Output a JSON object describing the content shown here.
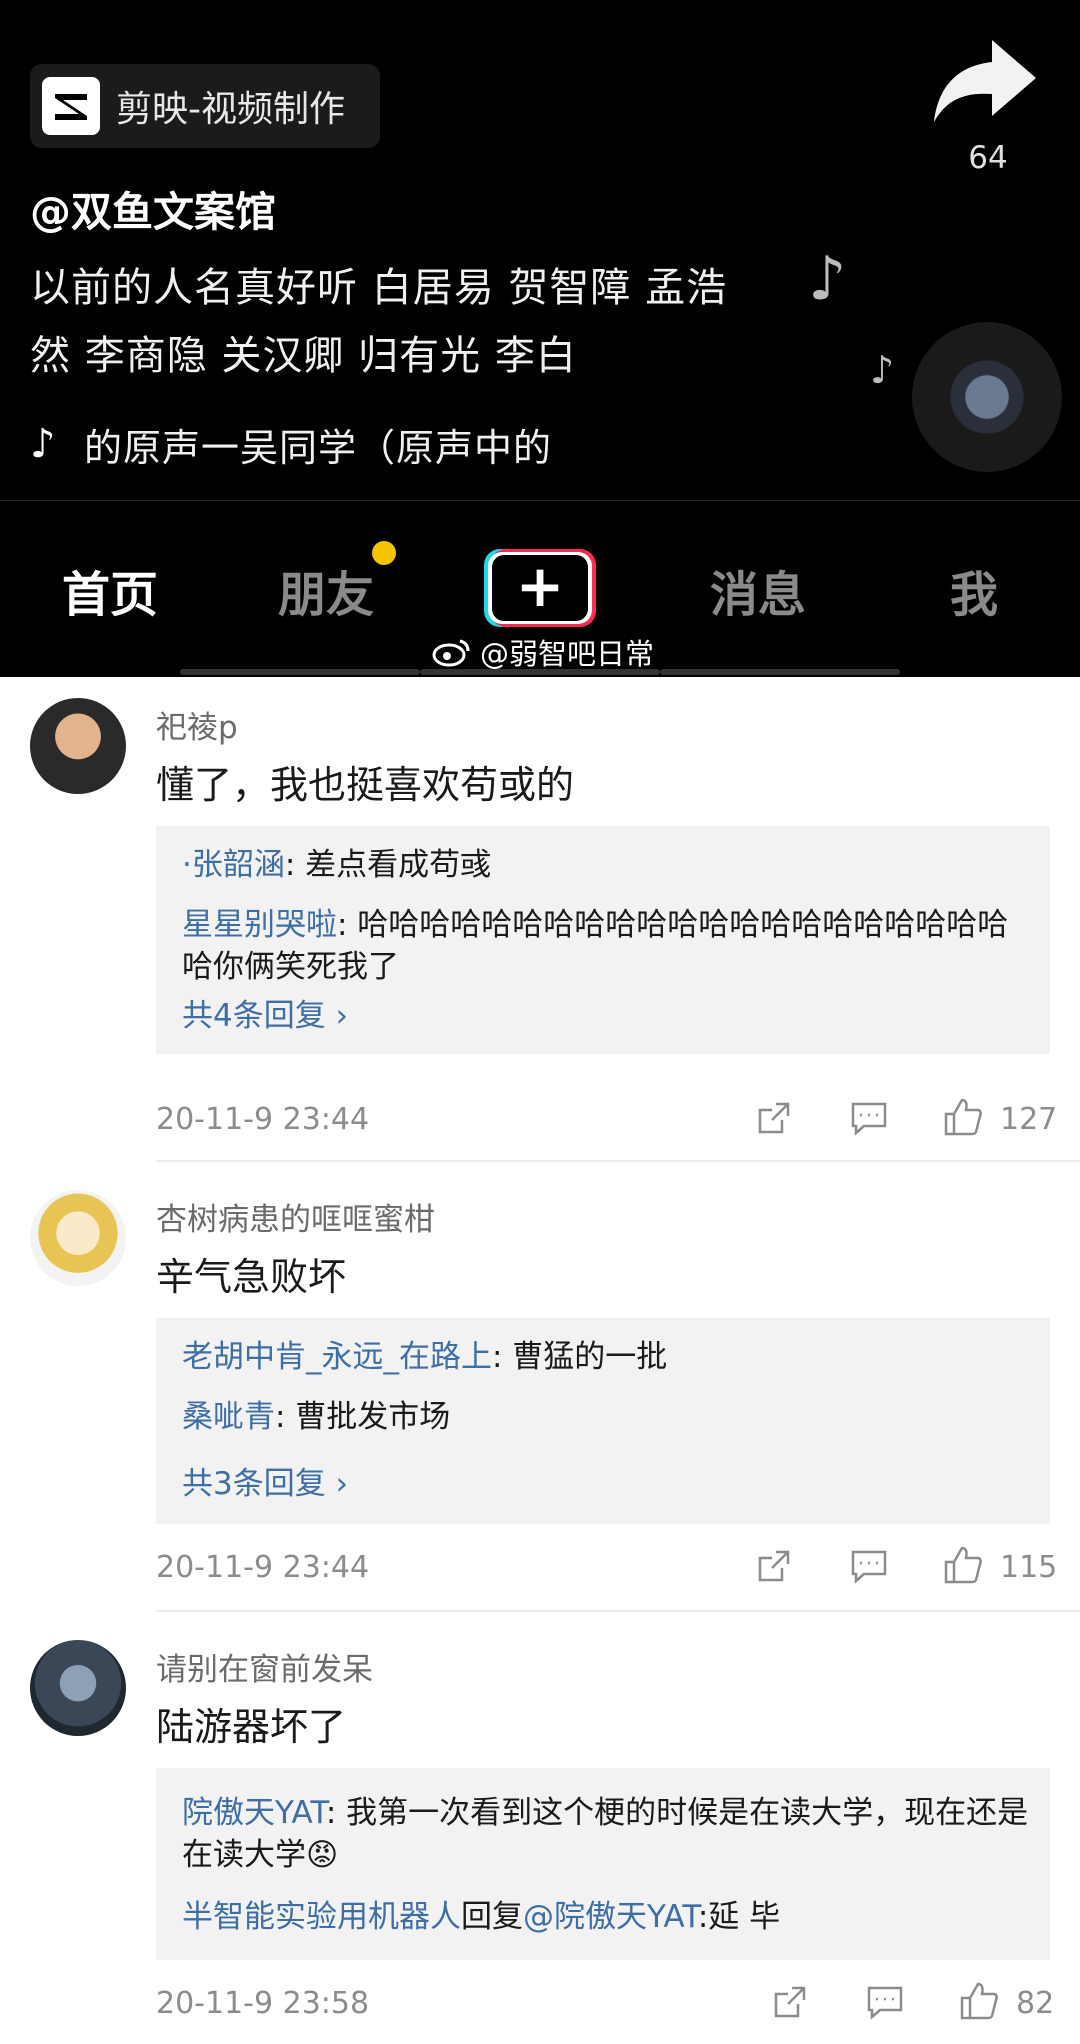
{
  "video": {
    "app_name": "剪映-视频制作",
    "share_count": "64",
    "author": "@双鱼文案馆",
    "caption": "以前的人名真好听 白居易 贺智障 孟浩然 李商隐 关汉卿 归有光 李白",
    "sound_text": "的原声一吴同学（原声中的"
  },
  "tabs": {
    "home": "首页",
    "friends": "朋友",
    "plus": "+",
    "messages": "消息",
    "me": "我"
  },
  "watermark": "@弱智吧日常",
  "comments": [
    {
      "user": "祀祾p",
      "text": "懂了，我也挺喜欢苟或的",
      "replies": [
        {
          "name": "·张韶涵",
          "text": ": 差点看成苟彧"
        },
        {
          "name": "星星别哭啦",
          "text": ": 哈哈哈哈哈哈哈哈哈哈哈哈哈哈哈哈哈哈哈哈哈哈你俩笑死我了"
        }
      ],
      "more": "共4条回复 ›",
      "time": "20-11-9 23:44",
      "likes": "127"
    },
    {
      "user": "杏树病患的哐哐蜜柑",
      "text": "辛气急败坏",
      "replies": [
        {
          "name": "老胡中肯_永远_在路上",
          "text": ": 曹猛的一批"
        },
        {
          "name": "桑呲青",
          "text": ": 曹批发市场"
        }
      ],
      "more": "共3条回复 ›",
      "time": "20-11-9 23:44",
      "likes": "115"
    },
    {
      "user": "请别在窗前发呆",
      "text": "陆游器坏了",
      "replies": [
        {
          "name": "院傲天YAT",
          "text": ": 我第一次看到这个梗的时候是在读大学，现在还是在读大学😡"
        },
        {
          "name": "半智能实验用机器人",
          "mid": "回复",
          "name2": "@院傲天YAT",
          "text": ":延  毕"
        }
      ],
      "time": "20-11-9 23:58",
      "likes": "82"
    }
  ],
  "icons": [
    "capcut-logo-icon",
    "share-arrow-icon",
    "music-note-icon",
    "tiktok-icon",
    "weibo-icon",
    "share-icon",
    "reply-icon",
    "like-icon"
  ],
  "colors": {
    "link": "#3d6ea6",
    "notify_dot": "#f5c400",
    "tiktok_cyan": "#20d5ec",
    "tiktok_red": "#fe2c55"
  }
}
